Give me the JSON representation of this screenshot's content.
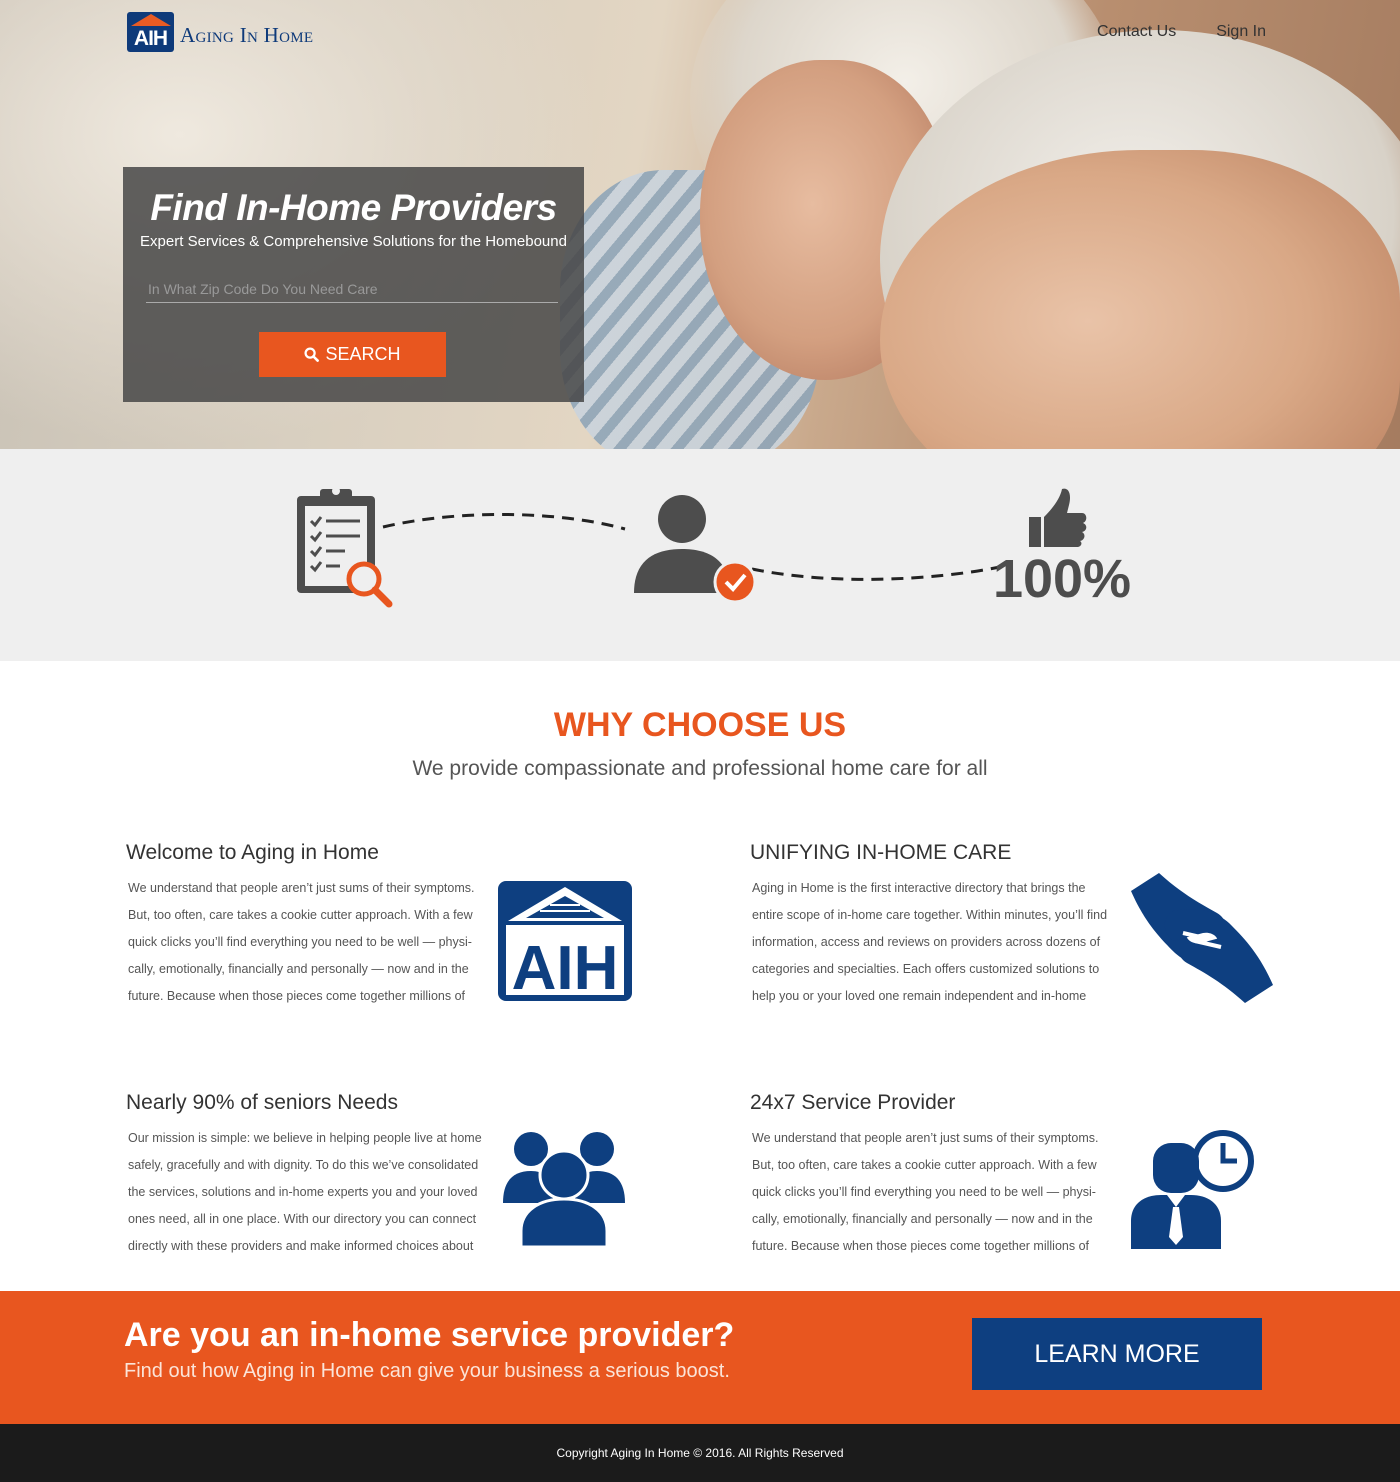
{
  "brand": {
    "badge": "AIH",
    "name": "Aging In Home"
  },
  "nav": {
    "contact": "Contact Us",
    "signin": "Sign In"
  },
  "hero": {
    "title": "Find In-Home Providers",
    "subtitle": "Expert Services & Comprehensive Solutions for the Homebound",
    "zip_placeholder": "In What Zip Code Do You Need Care",
    "search_label": "SEARCH"
  },
  "steps": {
    "percent": "100%"
  },
  "why": {
    "title": "WHY CHOOSE US",
    "subtitle": "We provide compassionate and professional home care for all"
  },
  "features": [
    {
      "title": "Welcome to Aging in Home",
      "text": "We understand that people aren’t just sums of their symptoms. But, too often, care takes a cookie cutter approach. With a few quick clicks you’ll find everything you need to be well — physi-cally, emotionally, financially and personally — now and in the future. Because when those pieces come together millions of"
    },
    {
      "title": "UNIFYING IN-HOME CARE",
      "text": "Aging in Home is the first interactive directory that brings the entire scope of in-home care together. Within minutes, you’ll find information, access and reviews on providers across dozens of categories and specialties. Each offers customized solutions to help you or your loved one remain independent and in-home"
    },
    {
      "title": "Nearly 90% of seniors Needs",
      "text": "Our mission is simple: we believe in helping people live at home safely, gracefully and with dignity. To do this we’ve consolidated the services, solutions and in-home experts you and your loved ones need, all in one place. With our directory you can connect directly with these providers and make informed choices about"
    },
    {
      "title": "24x7 Service Provider",
      "text": "We understand that people aren’t just sums of their symptoms. But, too often, care takes a cookie cutter approach. With a few quick clicks you’ll find everything you need to be well — physi-cally, emotionally, financially and personally — now and in the future. Because when those pieces come together millions of"
    }
  ],
  "feature_logo_text": "AIH",
  "cta": {
    "title": "Are you an in-home service provider?",
    "subtitle": "Find out how Aging in Home can give your business a serious boost.",
    "button": "LEARN MORE"
  },
  "footer": {
    "copyright": "Copyright Aging In Home © 2016. All Rights Reserved"
  },
  "colors": {
    "accent": "#e8561f",
    "brand_blue": "#0e3f80",
    "icon_gray": "#4d4d4d"
  }
}
